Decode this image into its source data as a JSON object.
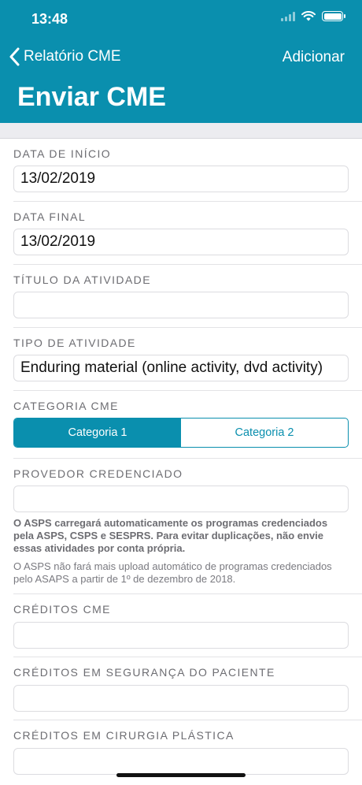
{
  "status_bar": {
    "time": "13:48"
  },
  "nav": {
    "back_label": "Relatório CME",
    "add_label": "Adicionar",
    "title": "Enviar CME"
  },
  "form": {
    "start_date": {
      "label": "DATA DE INÍCIO",
      "value": "13/02/2019"
    },
    "end_date": {
      "label": "DATA FINAL",
      "value": "13/02/2019"
    },
    "activity_title": {
      "label": "TÍTULO DA ATIVIDADE",
      "value": ""
    },
    "activity_type": {
      "label": "TIPO DE ATIVIDADE",
      "value": "Enduring material (online activity, dvd activity)"
    },
    "cme_category": {
      "label": "CATEGORIA CME",
      "options": [
        "Categoria 1",
        "Categoria 2"
      ],
      "selected": "Categoria 1"
    },
    "accredited_provider": {
      "label": "PROVEDOR CREDENCIADO",
      "value": ""
    },
    "notes": {
      "bold": "O ASPS carregará automaticamente os programas credenciados pela ASPS, CSPS e SESPRS. Para evitar duplicações, não envie essas atividades por conta própria.",
      "regular": "O ASPS não fará mais upload automático de programas credenciados pelo ASAPS a partir de 1º de dezembro de 2018."
    },
    "cme_credits": {
      "label": "CRÉDITOS CME",
      "value": ""
    },
    "patient_safety_credits": {
      "label": "CRÉDITOS EM SEGURANÇA DO PACIENTE",
      "value": ""
    },
    "plastic_surgery_credits": {
      "label": "CRÉDITOS EM CIRURGIA PLÁSTICA",
      "value": ""
    }
  },
  "colors": {
    "accent": "#0a8fae",
    "background": "#ffffff",
    "band": "#ececf0",
    "label": "#6d6d72"
  }
}
